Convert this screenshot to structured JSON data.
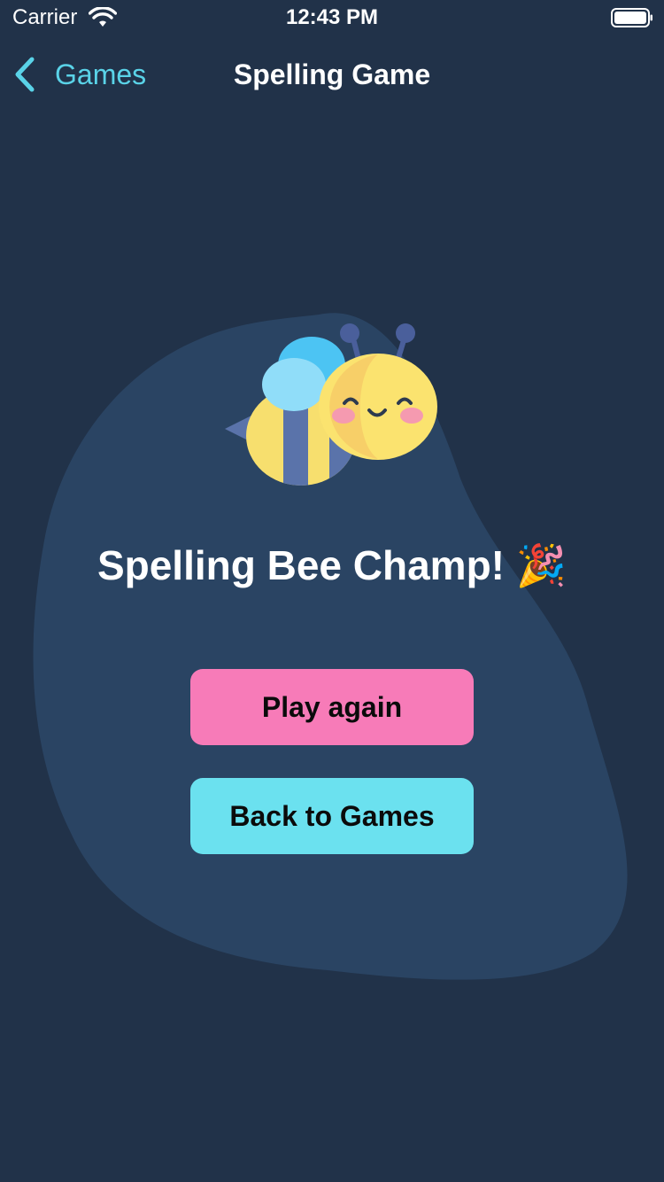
{
  "status_bar": {
    "carrier": "Carrier",
    "time": "12:43 PM"
  },
  "nav": {
    "back_label": "Games",
    "title": "Spelling Game"
  },
  "result": {
    "heading": "Spelling Bee Champ! 🎉"
  },
  "buttons": {
    "play_again": "Play again",
    "back_to_games": "Back to Games"
  },
  "colors": {
    "background": "#213249",
    "blob": "#2a4463",
    "accent": "#5ad3e8",
    "play_again_button": "#f77bb8",
    "back_to_games_button": "#6be1ef"
  },
  "icons": {
    "wifi": "wifi-icon",
    "battery": "battery-icon",
    "back": "chevron-left-icon",
    "illustration": "bee-illustration"
  }
}
